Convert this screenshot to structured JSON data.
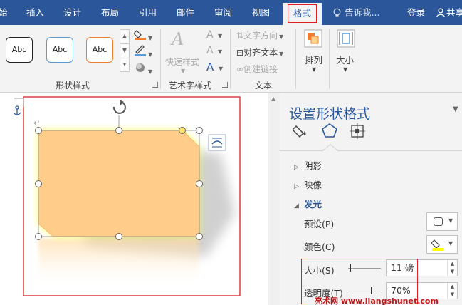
{
  "tabs": {
    "items": [
      "始",
      "插入",
      "设计",
      "布局",
      "引用",
      "邮件",
      "审阅",
      "视图"
    ],
    "active": "格式",
    "tell_me": "告诉我...",
    "login": "登录",
    "share": "共享"
  },
  "ribbon": {
    "shape_styles": {
      "samples": [
        "Abc",
        "Abc",
        "Abc"
      ],
      "label": "形状样式"
    },
    "wordart": {
      "quick_styles": "快速样式",
      "label": "艺术字样式"
    },
    "text": {
      "direction": "文字方向",
      "align": "对齐文本",
      "link": "创建链接",
      "label": "文本"
    },
    "arrange": {
      "label": "排列"
    },
    "size": {
      "label": "大小"
    }
  },
  "pane": {
    "title": "设置形状格式",
    "sections": {
      "shadow": "阴影",
      "reflection": "映像",
      "glow": "发光"
    },
    "glow": {
      "preset_label": "预设(P)",
      "color_label": "颜色(C)",
      "size_label": "大小(S)",
      "size_value": "11 磅",
      "transparency_label": "透明度(T)",
      "transparency_value": "70%"
    }
  },
  "watermark": "亮术网 www.liangshunet.com",
  "colors": {
    "ribbon_blue": "#2b579a",
    "highlight_red": "#e02020",
    "shape_fill": "#ffcc8a",
    "glow": "#ffff60",
    "accent_orange": "#ed7d31",
    "accent_blue": "#5b9bd5"
  }
}
